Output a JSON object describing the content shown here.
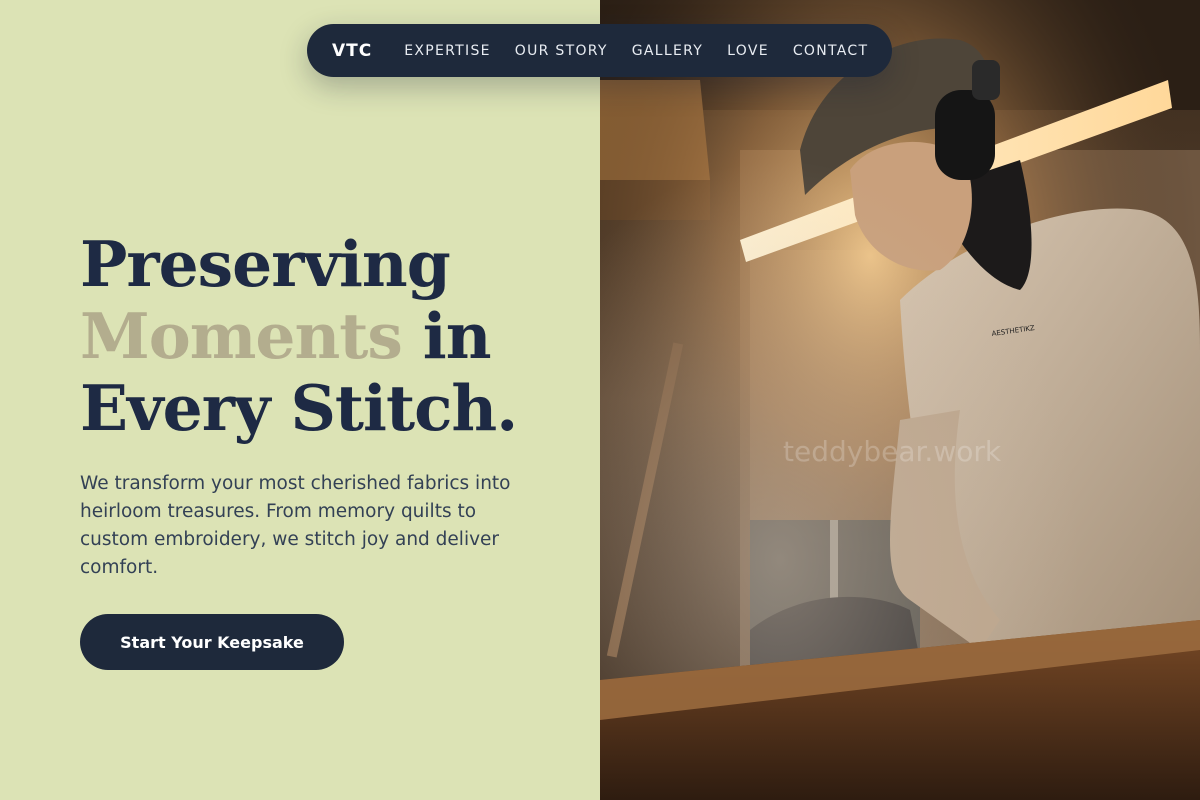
{
  "nav": {
    "logo": "VTC",
    "links": [
      "EXPERTISE",
      "OUR STORY",
      "GALLERY",
      "LOVE",
      "CONTACT"
    ]
  },
  "hero": {
    "headline_line1": "Preserving",
    "headline_accent": "Moments",
    "headline_line2_rest": " in",
    "headline_line3": "Every Stitch.",
    "body": "We transform your most cherished fabrics into heirloom treasures. From memory quilts to custom embroidery, we stitch joy and deliver comfort.",
    "cta_label": "Start Your Keepsake"
  },
  "image": {
    "watermark": "teddybear.work",
    "sweatshirt_print": "AESTHETIKZ"
  },
  "colors": {
    "background": "#dce3b5",
    "navy": "#1e293b",
    "accent": "#b3ad8e"
  }
}
